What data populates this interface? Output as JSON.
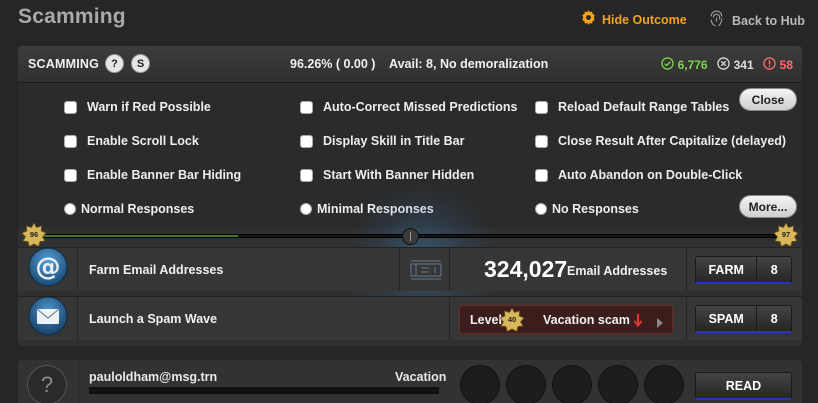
{
  "app_title": "Scamming",
  "top_actions": {
    "hide_outcome": "Hide Outcome",
    "back_to_hub": "Back to Hub"
  },
  "panel": {
    "title": "SCAMMING",
    "help_btn": "?",
    "dollar_btn": "S",
    "percent": "96.26% ( 0.00 )",
    "avail": "Avail: 8, No demoralization",
    "success_count": "6,776",
    "fail_count": "341",
    "alert_count": "58"
  },
  "options": {
    "col1": [
      {
        "label": "Warn if Red Possible",
        "checked": true
      },
      {
        "label": "Enable Scroll Lock",
        "checked": false
      },
      {
        "label": "Enable Banner Bar Hiding",
        "checked": true
      }
    ],
    "col2": [
      {
        "label": "Auto-Correct Missed Predictions",
        "checked": true
      },
      {
        "label": "Display Skill in Title Bar",
        "checked": true
      },
      {
        "label": "Start With Banner Hidden",
        "checked": true
      }
    ],
    "col3": [
      {
        "label": "Reload Default Range Tables",
        "checked": false
      },
      {
        "label": "Close Result After Capitalize (delayed)",
        "checked": false
      },
      {
        "label": "Auto Abandon on Double-Click",
        "checked": true
      }
    ],
    "radios": [
      {
        "label": "Normal Responses",
        "selected": false
      },
      {
        "label": "Minimal Responses",
        "selected": false
      },
      {
        "label": "No Responses",
        "selected": true
      }
    ],
    "close_btn": "Close",
    "more_btn": "More..."
  },
  "progress": {
    "left_level": "96",
    "right_level": "97",
    "fill_fraction": 0.27
  },
  "rows": [
    {
      "label": "Farm Email Addresses",
      "count": "324,027",
      "unit": "Email Addresses",
      "action": "FARM",
      "qty": "8"
    },
    {
      "label": "Launch a Spam Wave",
      "level_label": "Level",
      "level_value": "40",
      "scam_type": "Vacation scam",
      "action": "SPAM",
      "qty": "8"
    }
  ],
  "email_card": {
    "email": "pauloldham@msg.trn",
    "tag": "Vacation",
    "action": "READ",
    "slots": 5
  },
  "colors": {
    "accent_blue": "#2f7de1",
    "outcome_orange": "#f2a31b",
    "success_green": "#7fd14a",
    "alert_red": "#ff6a6a"
  }
}
